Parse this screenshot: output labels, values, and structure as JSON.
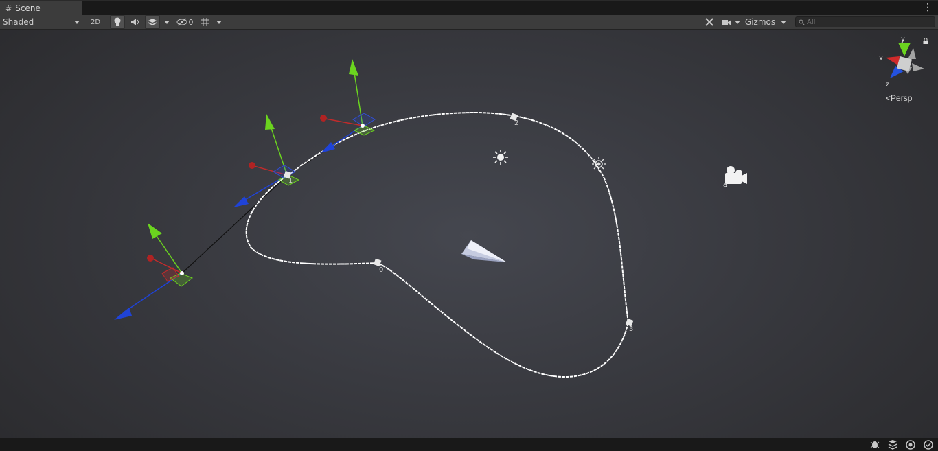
{
  "window": {
    "tab_title": "Scene"
  },
  "toolbar": {
    "shading_mode": "Shaded",
    "mode_2d_label": "2D",
    "hidden_count": "0",
    "gizmos_label": "Gizmos",
    "search_placeholder": "All"
  },
  "scene": {
    "waypoint_labels": [
      "0",
      "1",
      "2",
      "3"
    ]
  },
  "orientation_gizmo": {
    "axis_y": "y",
    "axis_x": "x",
    "axis_z": "z",
    "projection": "Persp"
  },
  "colors": {
    "axis_x": "#c22b2b",
    "axis_y": "#6bd41f",
    "axis_z": "#1f43d8",
    "path": "#ffffff"
  }
}
